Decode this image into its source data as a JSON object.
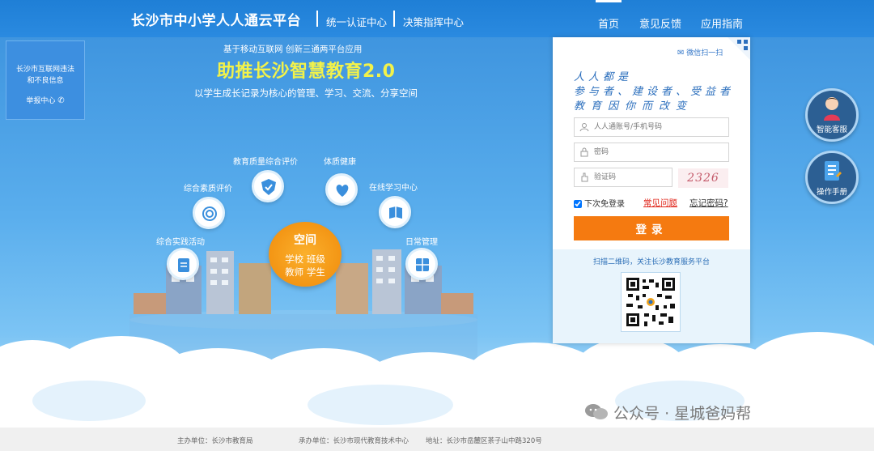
{
  "header": {
    "brand": "长沙市中小学人人通云平台",
    "links": [
      "统一认证中心",
      "决策指挥中心"
    ],
    "nav": [
      "首页",
      "意见反馈",
      "应用指南"
    ]
  },
  "report": {
    "line1": "长沙市互联网违法",
    "line2": "和不良信息",
    "line3": "举报中心"
  },
  "slogan": {
    "top": "基于移动互联网   创新三通两平台应用",
    "main": "助推长沙智慧教育2.0",
    "sub": "以学生成长记录为核心的管理、学习、交流、分享空间"
  },
  "features": [
    "教育质量综合评价",
    "体质健康",
    "综合素质评价",
    "在线学习中心",
    "综合实践活动",
    "日常管理"
  ],
  "center": {
    "title": "空间",
    "row1": "学校 班级",
    "row2": "教师 学生"
  },
  "login": {
    "wechat": "微信扫一扫",
    "tagline": [
      "人人都是",
      "参与者、建设者、受益者",
      "教育因你而改变"
    ],
    "username_placeholder": "人人通账号/手机号码",
    "password_placeholder": "密码",
    "captcha_placeholder": "验证码",
    "captcha_code": "2326",
    "remember": "下次免登录",
    "faq": "常见问题",
    "forgot": "忘记密码?",
    "submit": "登录",
    "scan_text": "扫描二维码，关注长沙教育服务平台"
  },
  "side": [
    "智能客服",
    "操作手册"
  ],
  "footer": [
    "主办单位：长沙市教育局",
    "承办单位：长沙市现代教育技术中心",
    "地址：长沙市岳麓区茶子山中路320号"
  ],
  "watermark": "公众号 · 星城爸妈帮",
  "colors": {
    "header": "#1f7fd6",
    "slogan": "#f2f24a",
    "login_button": "#f57a10",
    "center_badge": "#f08a0a"
  }
}
